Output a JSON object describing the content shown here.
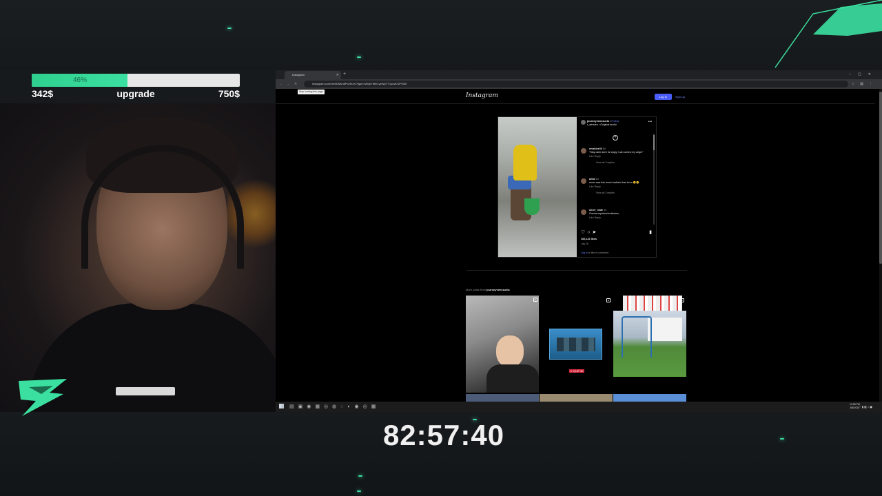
{
  "goal": {
    "progress_percent": 46,
    "progress_label": "46%",
    "current_amount": "342$",
    "title": "upgrade",
    "target_amount": "750$"
  },
  "timer": "82:57:40",
  "browser": {
    "tab_title": "Instagram",
    "url": "instagram.com/reel/DMkn8PUSKrX/?igsh=MWpYMm1yeWpYT1pcWXZPN30",
    "tooltip": "Stop loading this page"
  },
  "instagram": {
    "logo": "Instagram",
    "login_label": "Log In",
    "signup_label": "Sign Up",
    "post": {
      "author": "journeyvenezuela",
      "follow_label": "Follow",
      "audio": "r_almden • Original audio",
      "comments": [
        {
          "user": "eezakiee33",
          "time": "6d",
          "text": "\"Stay calm don't be angry I can control my anger\"",
          "meta": "Like   Reply",
          "views": "View all 3 replies"
        },
        {
          "user": "arbts",
          "time": "5d",
          "text": "never saw this much badluck than bro's 😩😂",
          "meta": "Like   Reply",
          "views": "View all 3 replies"
        },
        {
          "user": "oliver_mide",
          "time": "4d",
          "text": "Guerra espiritual fortissimo",
          "meta": "Like   Reply",
          "views": ""
        }
      ],
      "likes": "166,112 likes",
      "date": "July 26",
      "login_link": "Log in",
      "login_suffix": "to like or comment"
    },
    "more_posts_prefix": "More posts from",
    "more_posts_user": "journeyvenezuela",
    "grid_caption": "¡Y QUÉ 3K"
  },
  "taskbar": {
    "time": "12:56 PM",
    "date": "8/5/2025"
  },
  "colors": {
    "accent": "#3be0a0",
    "ig_blue": "#4a5df9"
  }
}
